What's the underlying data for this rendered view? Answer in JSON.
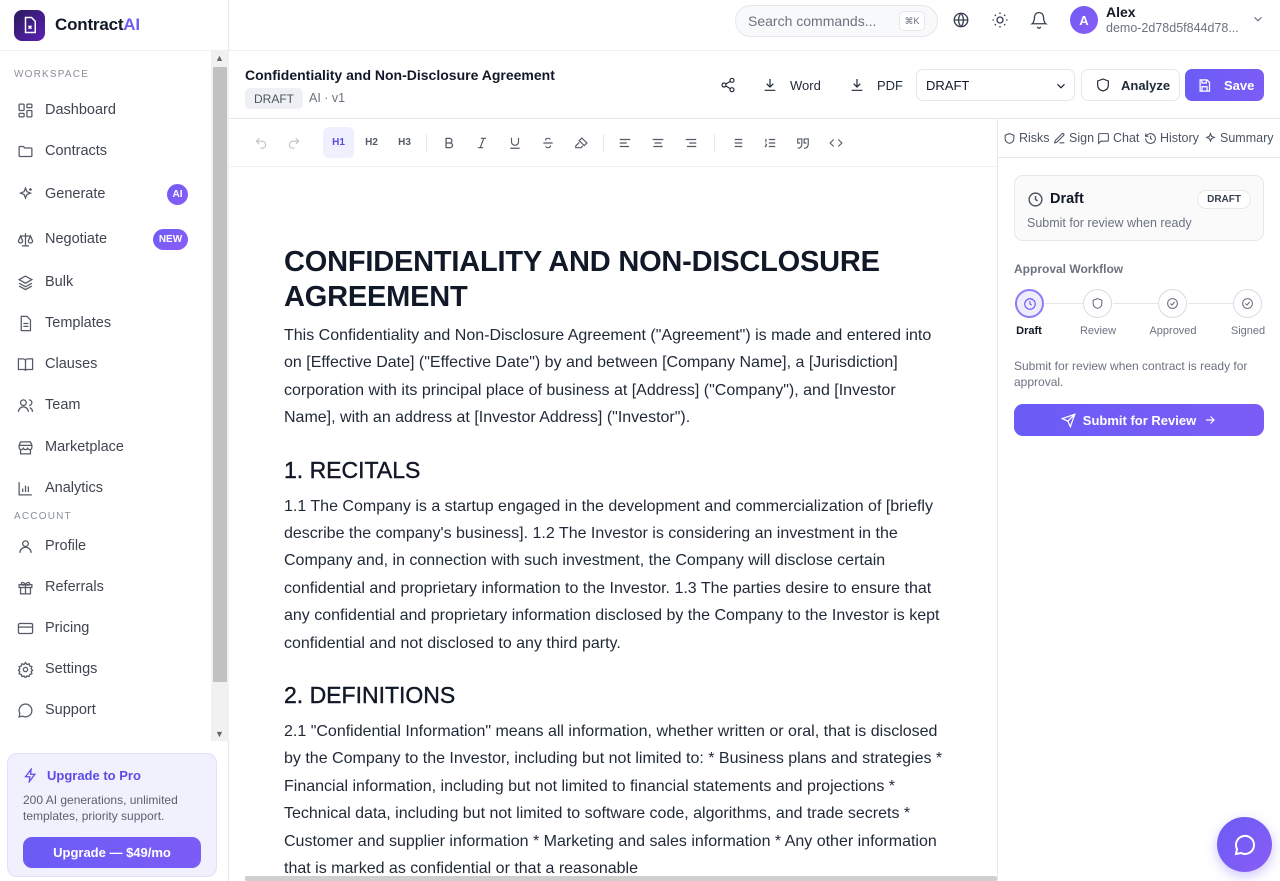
{
  "brand": {
    "name": "Contract",
    "name_accent": "AI"
  },
  "sidebar": {
    "workspace_label": "WORKSPACE",
    "account_label": "ACCOUNT",
    "items": [
      {
        "label": "Dashboard",
        "icon": "dashboard-icon"
      },
      {
        "label": "Contracts",
        "icon": "folder-icon"
      },
      {
        "label": "Generate",
        "icon": "sparkles-icon",
        "pill": "AI"
      },
      {
        "label": "Negotiate",
        "icon": "scale-icon",
        "pill": "NEW"
      },
      {
        "label": "Bulk",
        "icon": "layers-icon"
      },
      {
        "label": "Templates",
        "icon": "file-text-icon"
      },
      {
        "label": "Clauses",
        "icon": "book-open-icon"
      },
      {
        "label": "Team",
        "icon": "users-icon"
      },
      {
        "label": "Marketplace",
        "icon": "store-icon"
      },
      {
        "label": "Analytics",
        "icon": "bar-chart-icon"
      }
    ],
    "account_items": [
      {
        "label": "Profile",
        "icon": "user-icon"
      },
      {
        "label": "Referrals",
        "icon": "gift-icon"
      },
      {
        "label": "Pricing",
        "icon": "credit-card-icon"
      },
      {
        "label": "Settings",
        "icon": "gear-icon"
      },
      {
        "label": "Support",
        "icon": "message-circle-icon"
      }
    ],
    "upgrade": {
      "title": "Upgrade to Pro",
      "description": "200 AI generations, unlimited templates, priority support.",
      "button": "Upgrade — $49/mo"
    }
  },
  "topbar": {
    "search_placeholder": "Search commands...",
    "search_shortcut": "⌘K",
    "user": {
      "initial": "A",
      "name": "Alex",
      "id": "demo-2d78d5f844d78..."
    }
  },
  "document": {
    "title": "Confidentiality and Non-Disclosure Agreement",
    "badge": "DRAFT",
    "version": "AI · v1",
    "actions": {
      "word": "Word",
      "pdf": "PDF",
      "analyze": "Analyze",
      "save": "Save"
    },
    "status": "DRAFT",
    "heading": "CONFIDENTIALITY AND NON-DISCLOSURE AGREEMENT",
    "intro": " This Confidentiality and Non-Disclosure Agreement (\"Agreement\") is made and entered into on [Effective Date] (\"Effective Date\") by and between [Company Name], a [Jurisdiction] corporation with its principal place of business at [Address] (\"Company\"), and [Investor Name], with an address at [Investor Address] (\"Investor\").",
    "sections": [
      {
        "title": "1. RECITALS",
        "body": " 1.1 The Company is a startup engaged in the development and commercialization of [briefly describe the company's business]. 1.2 The Investor is considering an investment in the Company and, in connection with such investment, the Company will disclose certain confidential and proprietary information to the Investor. 1.3 The parties desire to ensure that any confidential and proprietary information disclosed by the Company to the Investor is kept confidential and not disclosed to any third party."
      },
      {
        "title": "2. DEFINITIONS",
        "body": " 2.1 \"Confidential Information\" means all information, whether written or oral, that is disclosed by the Company to the Investor, including but not limited to: * Business plans and strategies * Financial information, including but not limited to financial statements and projections * Technical data, including but not limited to software code, algorithms, and trade secrets * Customer and supplier information * Marketing and sales information * Any other information that is marked as confidential or that a reasonable"
      }
    ]
  },
  "toolbar": {
    "h1": "H1",
    "h2": "H2",
    "h3": "H3"
  },
  "right_panel": {
    "tabs": [
      "Risks",
      "Sign",
      "Chat",
      "History",
      "Summary"
    ],
    "status_card": {
      "title": "Draft",
      "badge": "DRAFT",
      "subtitle": "Submit for review when ready"
    },
    "workflow_title": "Approval Workflow",
    "steps": [
      "Draft",
      "Review",
      "Approved",
      "Signed"
    ],
    "description": "Submit for review when contract is ready for approval.",
    "submit_button": "Submit for Review"
  },
  "colors": {
    "accent": "#6a5cf5",
    "accent_light": "#eeedfe"
  }
}
